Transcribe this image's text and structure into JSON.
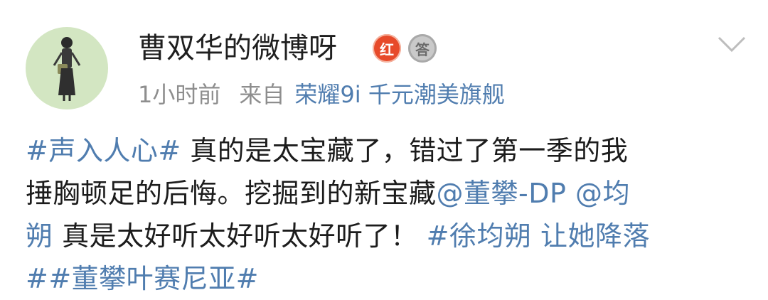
{
  "post": {
    "username": "曹双华的微博呀",
    "badges": {
      "red_label": "红",
      "grey_label": "答"
    },
    "meta": {
      "time": "1小时前",
      "source_prefix": "来自",
      "device": "荣耀9i 千元潮美旗舰"
    },
    "icons": {
      "avatar": "avatar-girl-illustration",
      "menu": "chevron-down-icon"
    },
    "colors": {
      "link": "#507daf",
      "badge_red": "#e74a2a",
      "avatar_bg": "#d3e6c2"
    },
    "content": {
      "line1_tag": "#声入人心#",
      "line1_text": " 真的是太宝藏了，错过了第一季的我",
      "line2_text": "捶胸顿足的后悔。挖掘到的新宝藏",
      "line2_mention1": "@董攀-DP",
      "line2_space": " ",
      "line2_mention2_part1": "@均",
      "line3_mention2_part2": "朔",
      "line3_text": " 真是太好听太好听太好听了！",
      "line3_tag": "#徐均朔 让她降落",
      "line4_tag": "##董攀叶赛尼亚#"
    }
  }
}
